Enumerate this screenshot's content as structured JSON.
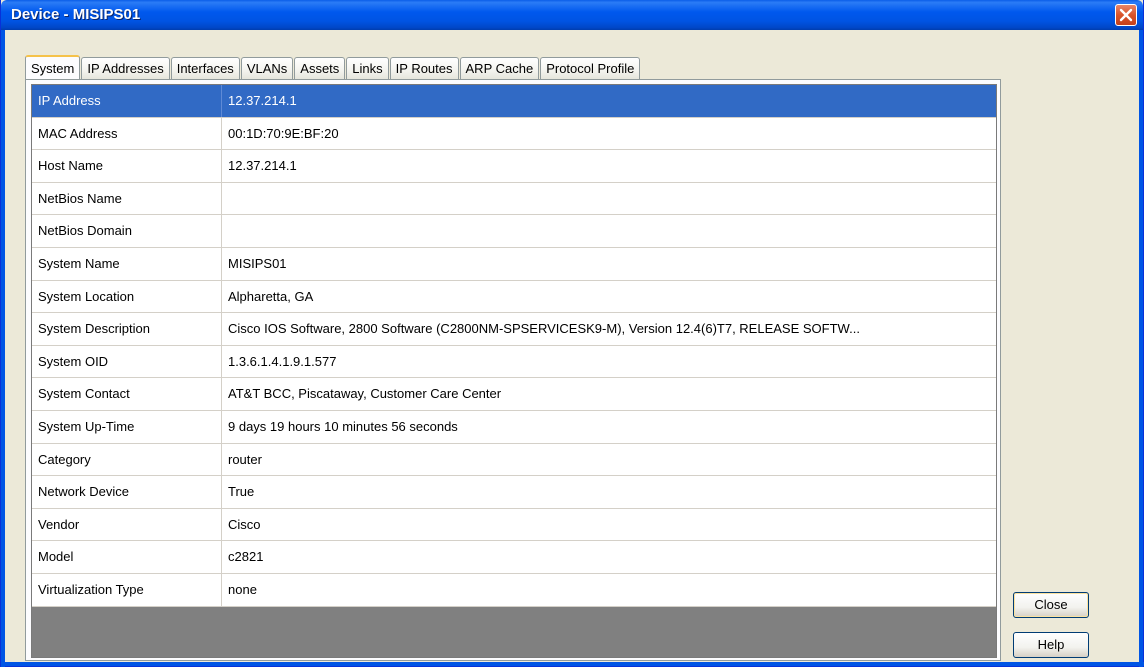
{
  "window": {
    "title": "Device - MISIPS01"
  },
  "tabs": [
    {
      "label": "System",
      "active": true
    },
    {
      "label": "IP Addresses",
      "active": false
    },
    {
      "label": "Interfaces",
      "active": false
    },
    {
      "label": "VLANs",
      "active": false
    },
    {
      "label": "Assets",
      "active": false
    },
    {
      "label": "Links",
      "active": false
    },
    {
      "label": "IP Routes",
      "active": false
    },
    {
      "label": "ARP Cache",
      "active": false
    },
    {
      "label": "Protocol Profile",
      "active": false
    }
  ],
  "properties": [
    {
      "name": "IP Address",
      "value": "12.37.214.1",
      "selected": true
    },
    {
      "name": "MAC Address",
      "value": "00:1D:70:9E:BF:20"
    },
    {
      "name": "Host Name",
      "value": "12.37.214.1"
    },
    {
      "name": "NetBios Name",
      "value": ""
    },
    {
      "name": "NetBios Domain",
      "value": ""
    },
    {
      "name": "System Name",
      "value": "MISIPS01"
    },
    {
      "name": "System Location",
      "value": "Alpharetta, GA"
    },
    {
      "name": "System Description",
      "value": "Cisco IOS Software, 2800 Software (C2800NM-SPSERVICESK9-M), Version 12.4(6)T7, RELEASE SOFTW..."
    },
    {
      "name": "System OID",
      "value": "1.3.6.1.4.1.9.1.577"
    },
    {
      "name": "System Contact",
      "value": "AT&T BCC, Piscataway, Customer Care Center"
    },
    {
      "name": "System Up-Time",
      "value": "9 days 19 hours 10 minutes 56 seconds"
    },
    {
      "name": "Category",
      "value": "router"
    },
    {
      "name": "Network Device",
      "value": "True"
    },
    {
      "name": "Vendor",
      "value": "Cisco"
    },
    {
      "name": "Model",
      "value": "c2821"
    },
    {
      "name": "Virtualization Type",
      "value": "none"
    }
  ],
  "buttons": {
    "close": "Close",
    "help": "Help"
  },
  "colors": {
    "titlebar": "#0054e3",
    "selection": "#316ac5",
    "dialog_bg": "#ece9d8",
    "grid_empty": "#808080"
  },
  "icons": {
    "window_close": "close-icon"
  }
}
